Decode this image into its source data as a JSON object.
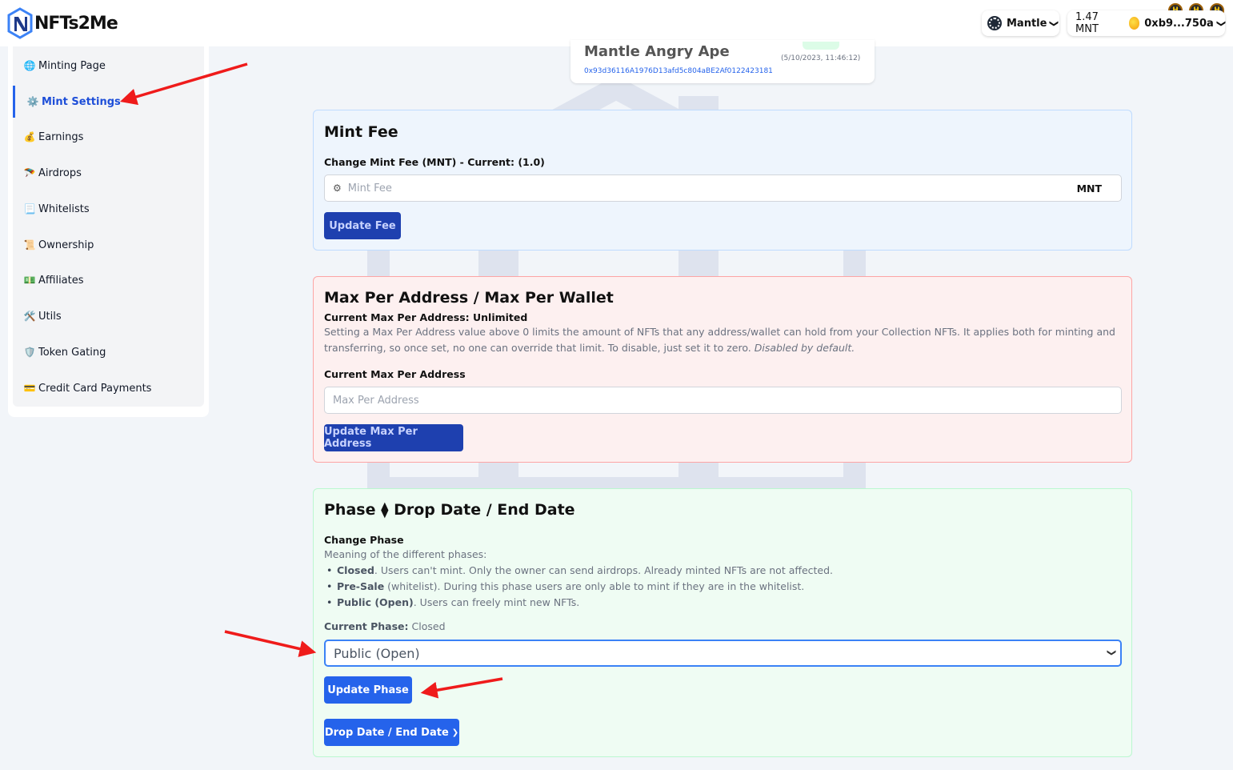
{
  "header": {
    "logo_text": "NFTs2Me",
    "network": {
      "name": "Mantle",
      "icon": "mantle-network-icon"
    },
    "wallet": {
      "balance": "1.47 MNT",
      "address": "0xb9...750a",
      "icon": "wallet-coin-icon"
    },
    "badges": [
      "H",
      "H",
      "H"
    ]
  },
  "sidebar": {
    "items": [
      {
        "icon": "🌐",
        "label": "Minting Page",
        "active": false
      },
      {
        "icon": "⚙️",
        "label": "Mint Settings",
        "active": true
      },
      {
        "icon": "💰",
        "label": "Earnings",
        "active": false
      },
      {
        "icon": "🪂",
        "label": "Airdrops",
        "active": false
      },
      {
        "icon": "📃",
        "label": "Whitelists",
        "active": false
      },
      {
        "icon": "📜",
        "label": "Ownership",
        "active": false
      },
      {
        "icon": "💵",
        "label": "Affiliates",
        "active": false
      },
      {
        "icon": "🛠️",
        "label": "Utils",
        "active": false
      },
      {
        "icon": "🛡️",
        "label": "Token Gating",
        "active": false
      },
      {
        "icon": "💳",
        "label": "Credit Card Payments",
        "active": false
      }
    ]
  },
  "collection_card": {
    "title": "Mantle Angry Ape",
    "date": "(5/10/2023, 11:46:12)",
    "address": "0x93d36116A1976D13afd5c804aBE2Af0122423181"
  },
  "mint_fee": {
    "title": "Mint Fee",
    "label": "Change Mint Fee (MNT) - Current: (1.0)",
    "placeholder": "Mint Fee",
    "unit": "MNT",
    "button": "Update Fee"
  },
  "max_per_address": {
    "title": "Max Per Address / Max Per Wallet",
    "current": "Current Max Per Address: Unlimited",
    "description": "Setting a Max Per Address value above 0 limits the amount of NFTs that any address/wallet can hold from your Collection NFTs. It applies both for minting and transferring, so once set, no one can override that limit. To disable, just set it to zero.",
    "description_em": "Disabled by default.",
    "field_label": "Current Max Per Address",
    "placeholder": "Max Per Address",
    "button": "Update Max Per Address"
  },
  "phase": {
    "title_left": "Phase",
    "title_sep": "⧫",
    "title_right": "Drop Date / End Date",
    "change_label": "Change Phase",
    "meaning": "Meaning of the different phases:",
    "items": [
      {
        "term": "Closed",
        "text": ". Users can't mint. Only the owner can send airdrops. Already minted NFTs are not affected."
      },
      {
        "term": "Pre-Sale",
        "text": " (whitelist). During this phase users are only able to mint if they are in the whitelist."
      },
      {
        "term": "Public (Open)",
        "text": ". Users can freely mint new NFTs."
      }
    ],
    "current_label": "Current Phase:",
    "current_value": "Closed",
    "selected_option": "Public (Open)",
    "update_button": "Update Phase",
    "date_button": "Drop Date / End Date"
  }
}
